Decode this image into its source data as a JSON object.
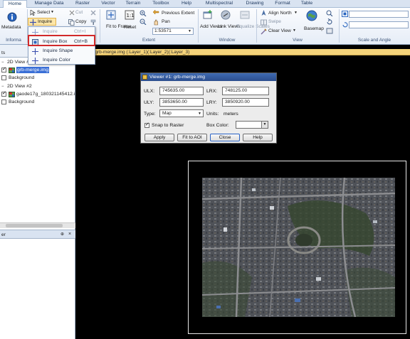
{
  "tabs": [
    "Home",
    "Manage Data",
    "Raster",
    "Vector",
    "Terrain",
    "Toolbox",
    "Help",
    "Multispectral",
    "Drawing",
    "Format",
    "Table"
  ],
  "ribbon": {
    "metadata_label": "Metadata",
    "select_label": "Select",
    "inquire_label": "Inquire",
    "cut_label": "Cut",
    "copy_label": "Copy",
    "fit_to_frame_label": "Fit to Frame",
    "reset_label": "Reset",
    "previous_extent_label": "Previous Extent",
    "pan_label": "Pan",
    "scale_value": "1:53571",
    "add_views_label": "Add Views",
    "link_views_label": "Link Views",
    "equalize_scales_label": "Equalize Scales",
    "align_north_label": "Align North",
    "swipe_label": "Swipe",
    "clear_view_label": "Clear View",
    "basemap_label": "Basemap",
    "groups": {
      "information": "Informa",
      "extent": "Extent",
      "window": "Window",
      "view": "View",
      "scale_angle": "Scale and Angle"
    }
  },
  "dropdown": {
    "items": [
      {
        "label": "Inquire",
        "shortcut": "Ctrl+I"
      },
      {
        "label": "Inquire Box",
        "shortcut": "Ctrl+B"
      },
      {
        "label": "Inquire Shape",
        "shortcut": ""
      },
      {
        "label": "Inquire Color",
        "shortcut": ""
      }
    ]
  },
  "contents": {
    "header": "ts",
    "items": [
      {
        "label": "2D View #1",
        "checked": false
      },
      {
        "label": "grb-merge.img",
        "checked": true,
        "selected": true
      },
      {
        "label": "Background",
        "checked": false
      },
      {
        "label": "2D View #2",
        "checked": false
      },
      {
        "label": "gaode17g_180321145412.i",
        "checked": true
      },
      {
        "label": "Background",
        "checked": false
      }
    ],
    "bottom_panel_title": "er"
  },
  "viewer_title": "w #1: grb-merge.img (:Layer_1)(:Layer_2)(:Layer_3)",
  "dialog": {
    "title": "Viewer #1: grb-merge.img",
    "ulx_label": "ULX:",
    "ulx_value": "745635.00",
    "lrx_label": "LRX:",
    "lrx_value": "748125.00",
    "uly_label": "ULY:",
    "uly_value": "3853650.00",
    "lry_label": "LRY:",
    "lry_value": "3850920.00",
    "type_label": "Type:",
    "type_value": "Map",
    "units_label": "Units:",
    "units_value": "meters",
    "snap_label": "Snap to Raster",
    "box_color_label": "Box Color:",
    "buttons": [
      "Apply",
      "Fit to AOI",
      "Close",
      "Help"
    ]
  },
  "colors": {
    "ribbon_bg": "#e6edf7",
    "highlight": "#d22a2a",
    "viewer_title_bg": "#f5d37a",
    "dialog_title_bg": "#2c4e8e"
  }
}
